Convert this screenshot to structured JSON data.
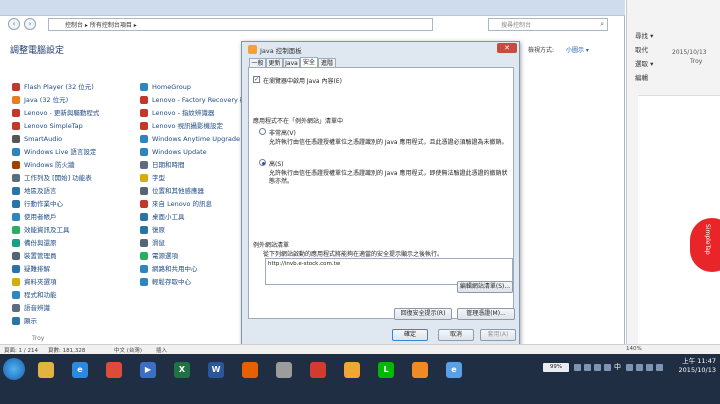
{
  "control_panel": {
    "address": "控制台 ▸ 所有控制台項目 ▸",
    "search_placeholder": "搜尋控制台",
    "heading": "調整電腦設定",
    "view_by_label": "檢視方式:",
    "view_by_value": "小圖示 ▾",
    "col1": [
      {
        "label": "Flash Player (32 位元)",
        "color": "#c0392b"
      },
      {
        "label": "Java (32 位元)",
        "color": "#e67e22"
      },
      {
        "label": "Lenovo - 更新與驅動程式",
        "color": "#c0392b"
      },
      {
        "label": "Lenovo SimpleTap",
        "color": "#c0392b"
      },
      {
        "label": "SmartAudio",
        "color": "#555555"
      },
      {
        "label": "Windows Live 語言設定",
        "color": "#2e86c1"
      },
      {
        "label": "Windows 防火牆",
        "color": "#a04000"
      },
      {
        "label": "工作列及 [開始] 功能表",
        "color": "#5d6d7e"
      },
      {
        "label": "地區及語言",
        "color": "#2874a6"
      },
      {
        "label": "行動作業中心",
        "color": "#2874a6"
      },
      {
        "label": "使用者帳戶",
        "color": "#2e86c1"
      },
      {
        "label": "效能資訊及工具",
        "color": "#27ae60"
      },
      {
        "label": "備份與還原",
        "color": "#16a085"
      },
      {
        "label": "裝置管理員",
        "color": "#566573"
      },
      {
        "label": "疑難排解",
        "color": "#2874a6"
      },
      {
        "label": "資料夾選項",
        "color": "#d4ac0d"
      },
      {
        "label": "程式和功能",
        "color": "#2e86c1"
      },
      {
        "label": "語音辨識",
        "color": "#5d6d7e"
      },
      {
        "label": "顯示",
        "color": "#2874a6"
      }
    ],
    "col2": [
      {
        "label": "HomeGroup",
        "color": "#2e86c1"
      },
      {
        "label": "Lenovo - Factory Recovery 磁碟",
        "color": "#c0392b"
      },
      {
        "label": "Lenovo - 指紋辨識器",
        "color": "#c0392b"
      },
      {
        "label": "Lenovo 視訊攝影機設定",
        "color": "#c0392b"
      },
      {
        "label": "Windows Anytime Upgrade",
        "color": "#2e86c1"
      },
      {
        "label": "Windows Update",
        "color": "#2e86c1"
      },
      {
        "label": "日期和時間",
        "color": "#5d6d7e"
      },
      {
        "label": "字型",
        "color": "#d4ac0d"
      },
      {
        "label": "位置和其他感應器",
        "color": "#566573"
      },
      {
        "label": "來自 Lenovo 的訊息",
        "color": "#c0392b"
      },
      {
        "label": "桌面小工具",
        "color": "#2874a6"
      },
      {
        "label": "復原",
        "color": "#2874a6"
      },
      {
        "label": "滑鼠",
        "color": "#566573"
      },
      {
        "label": "電源選項",
        "color": "#27ae60"
      },
      {
        "label": "網路和共用中心",
        "color": "#2e86c1"
      },
      {
        "label": "輕鬆存取中心",
        "color": "#2e86c1"
      }
    ]
  },
  "word": {
    "ribbon": [
      "尋找 ▾",
      "取代",
      "選取 ▾",
      "編輯"
    ],
    "date": "2015/10/13",
    "author": "Troy"
  },
  "simple_tap": "SimpleTap",
  "java": {
    "title": "Java 控制面板",
    "tabs": [
      "一般",
      "更新",
      "Java",
      "安全",
      "進階"
    ],
    "active_tab": 3,
    "enable_checkbox": "在瀏覽器中啟用 Java 內容(E)",
    "enable_checked": true,
    "security_level_title": "應用程式不在「例外網站」清單中",
    "very_high_label": "非常高(V)",
    "very_high_desc": "允許執行由信任憑證授權單位之憑證識別的 Java 應用程式，且此憑證必須驗證為未撤銷。",
    "high_label": "高(S)",
    "high_desc": "允許執行由信任憑證授權單位之憑證識別的 Java 應用程式，即使無法驗證此憑證的撤銷狀態亦然。",
    "selected_level": "high",
    "exception_title": "例外網站清單",
    "exception_desc": "從下列網站啟動的應用程式將能夠在適當的安全提示顯示之後執行。",
    "exception_sites": [
      "http://invb.e-stock.com.tw"
    ],
    "edit_sites_button": "編輯網站清單(S)...",
    "restore_prompts_button": "回復安全提示(R)",
    "manage_certs_button": "管理憑證(M)...",
    "ok_button": "確定",
    "cancel_button": "取消",
    "apply_button": "套用(A)"
  },
  "status_bar": {
    "page": "頁面: 1 / 214",
    "pos": "頁數: 181,328",
    "lang": "中文 (台灣)",
    "mode": "插入",
    "zoom": "140%"
  },
  "taskbar": {
    "battery": "99%",
    "ime": "中",
    "time": "上午 11:47",
    "date": "2015/10/13",
    "apps": [
      {
        "name": "explorer",
        "glyph": "",
        "color": "#e1b341"
      },
      {
        "name": "ie",
        "glyph": "e",
        "color": "#2b8ae0"
      },
      {
        "name": "chrome",
        "glyph": "",
        "color": "#dd4b39"
      },
      {
        "name": "media",
        "glyph": "▶",
        "color": "#3a6fc4"
      },
      {
        "name": "excel",
        "glyph": "X",
        "color": "#1f7244"
      },
      {
        "name": "word",
        "glyph": "W",
        "color": "#2b579a"
      },
      {
        "name": "firefox",
        "glyph": "",
        "color": "#e66000"
      },
      {
        "name": "calc",
        "glyph": "",
        "color": "#9c9c9c"
      },
      {
        "name": "paint",
        "glyph": "",
        "color": "#d43b2f"
      },
      {
        "name": "photos",
        "glyph": "",
        "color": "#f0a830"
      },
      {
        "name": "line",
        "glyph": "L",
        "color": "#00b900"
      },
      {
        "name": "java",
        "glyph": "",
        "color": "#f08a24"
      },
      {
        "name": "ie2",
        "glyph": "e",
        "color": "#5aa0e6"
      }
    ]
  }
}
